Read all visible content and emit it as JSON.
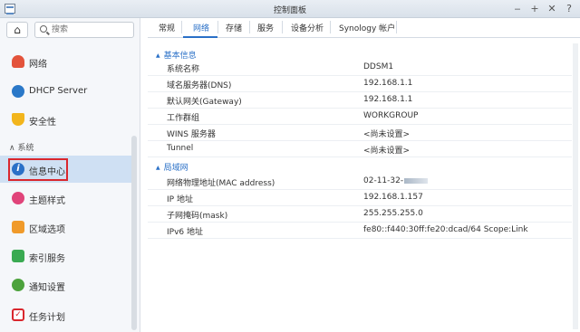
{
  "window": {
    "title": "控制面板",
    "minimize_glyph": "‒",
    "maximize_glyph": "+",
    "close_glyph": "✕",
    "extra_glyph": "?"
  },
  "sidebar": {
    "home_icon": "home-icon",
    "search": {
      "placeholder": "搜索",
      "value": ""
    },
    "section_label": "系统",
    "items": [
      {
        "label": "网络",
        "icon": "network-icon",
        "color": "#e3533b"
      },
      {
        "label": "DHCP Server",
        "icon": "dhcp-icon",
        "color": "#2a78c8"
      },
      {
        "label": "安全性",
        "icon": "shield-icon",
        "color": "#f2b51c"
      },
      {
        "label": "信息中心",
        "icon": "info-icon",
        "color": "#2a70c7",
        "active": true
      },
      {
        "label": "主题样式",
        "icon": "palette-icon",
        "color": "#e0447a"
      },
      {
        "label": "区域选项",
        "icon": "region-icon",
        "color": "#f09a2a"
      },
      {
        "label": "索引服务",
        "icon": "index-icon",
        "color": "#3aaa52"
      },
      {
        "label": "通知设置",
        "icon": "chat-icon",
        "color": "#4ca23c"
      },
      {
        "label": "任务计划",
        "icon": "calendar-icon",
        "color": "#d9272e"
      }
    ]
  },
  "tabs": [
    "常规",
    "网络",
    "存储",
    "服务",
    "设备分析",
    "Synology 帐户"
  ],
  "active_tab": "网络",
  "groups": [
    {
      "title": "基本信息",
      "rows": [
        {
          "key": "系统名称",
          "value": "DDSM1"
        },
        {
          "key": "域名服务器(DNS)",
          "value": "192.168.1.1"
        },
        {
          "key": "默认网关(Gateway)",
          "value": "192.168.1.1"
        },
        {
          "key": "工作群组",
          "value": "WORKGROUP"
        },
        {
          "key": "WINS 服务器",
          "value": "<尚未设置>"
        },
        {
          "key": "Tunnel",
          "value": "<尚未设置>"
        }
      ]
    },
    {
      "title": "局域网",
      "rows": [
        {
          "key": "网络物理地址(MAC address)",
          "value": "02-11-32-"
        },
        {
          "key": "IP 地址",
          "value": "192.168.1.157"
        },
        {
          "key": "子网掩码(mask)",
          "value": "255.255.255.0"
        },
        {
          "key": "IPv6 地址",
          "value": "fe80::f440:30ff:fe20:dcad/64 Scope:Link"
        }
      ]
    }
  ],
  "colors": {
    "accent": "#2a70c7",
    "highlight_border": "#d9272e",
    "active_bg": "#cfe0f3"
  }
}
